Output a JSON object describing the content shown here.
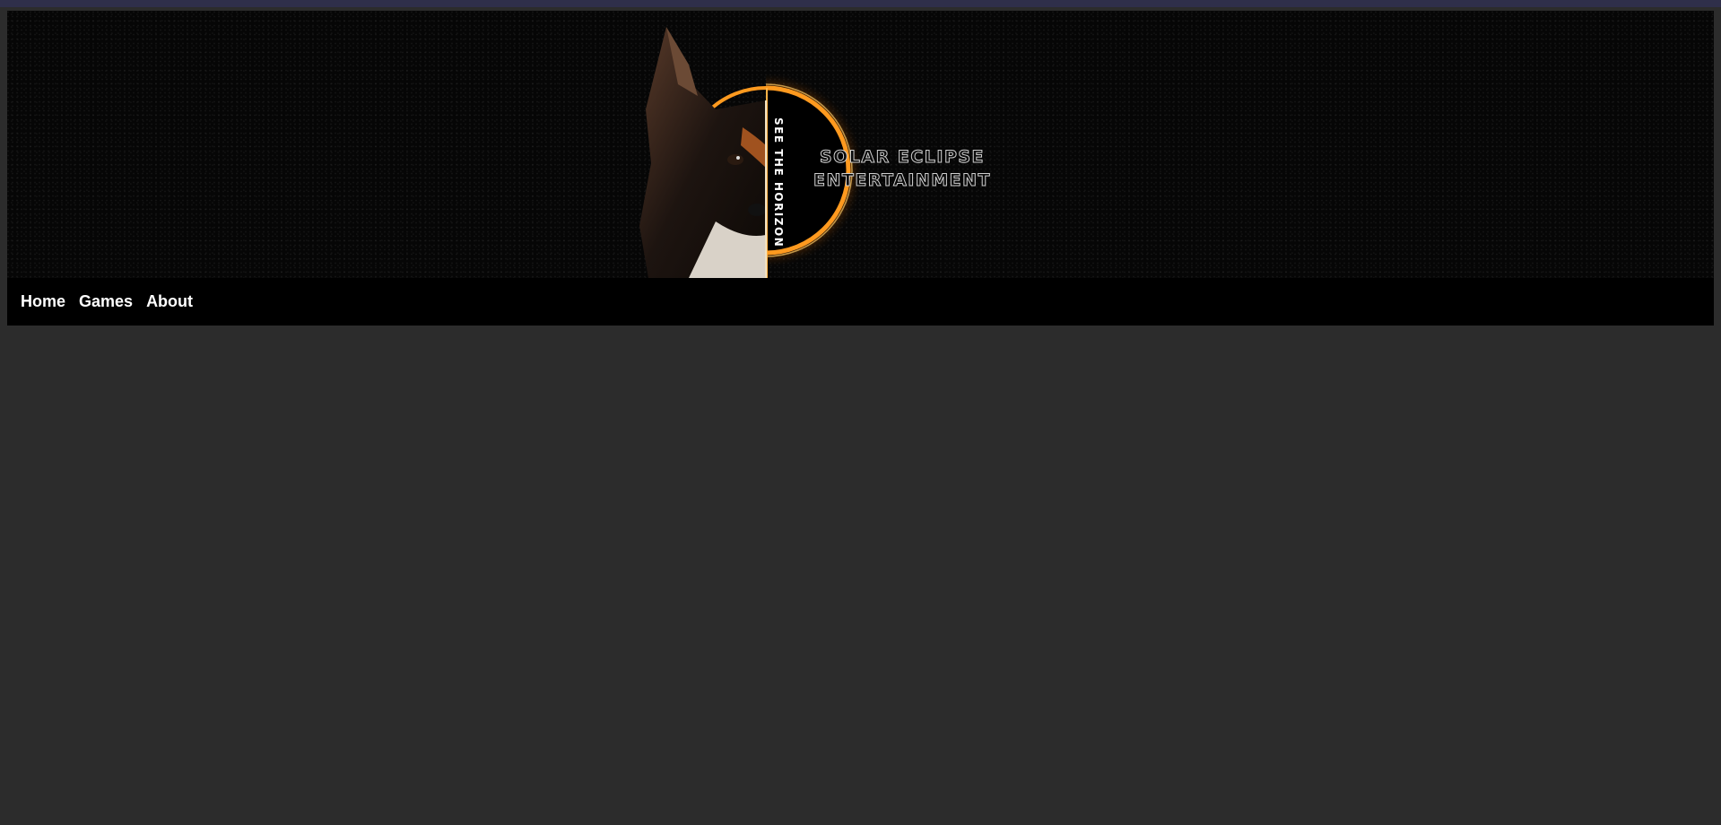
{
  "banner": {
    "tagline": "SEE THE HORIZON",
    "brand_line1": "SOLAR ECLIPSE",
    "brand_line2": "ENTERTAINMENT"
  },
  "nav": {
    "items": [
      {
        "label": "Home"
      },
      {
        "label": "Games"
      },
      {
        "label": "About"
      }
    ]
  },
  "colors": {
    "page_background": "#2c2c2c",
    "header_background": "#000000",
    "top_strip": "#2f2f4a",
    "eclipse_ring": "#ff8c1a",
    "nav_text": "#ffffff"
  }
}
